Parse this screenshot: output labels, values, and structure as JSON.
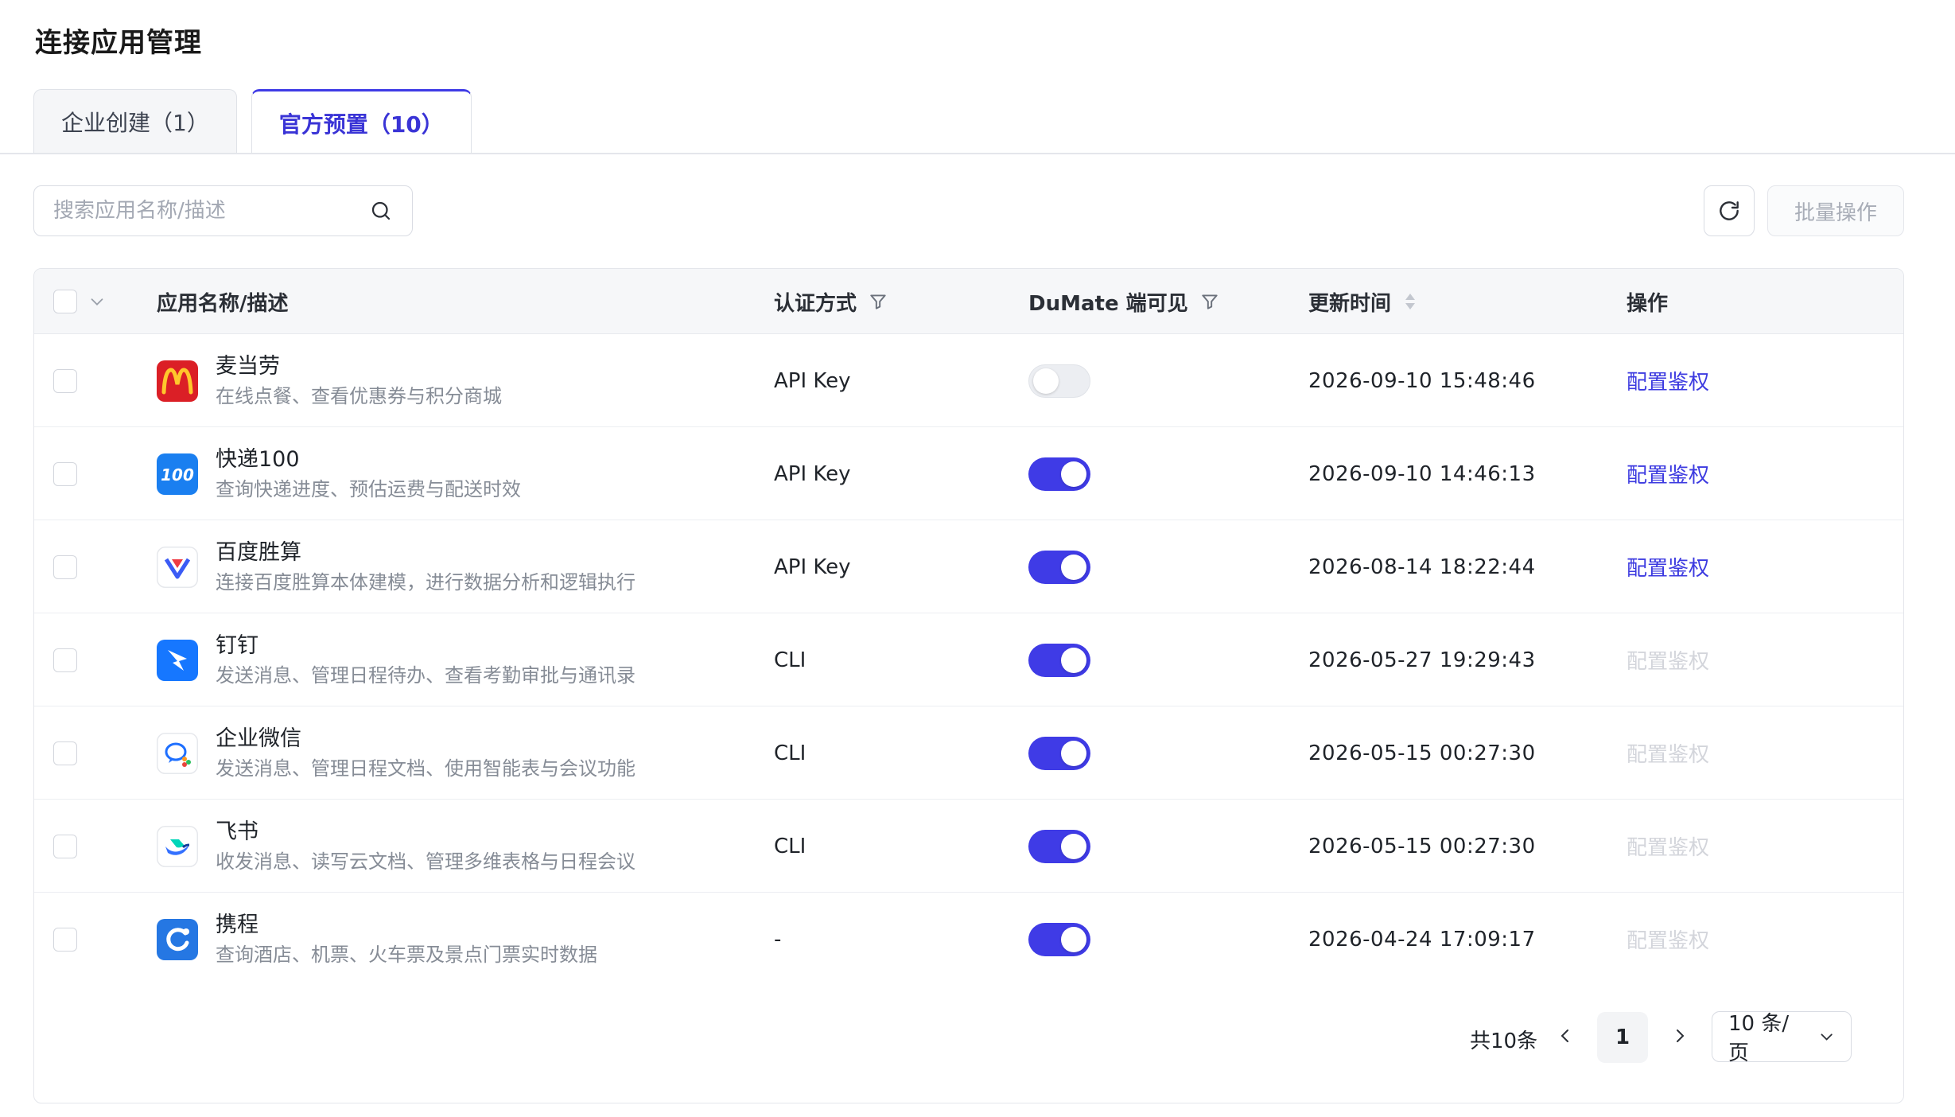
{
  "page": {
    "title": "连接应用管理"
  },
  "tabs": [
    {
      "label": "企业创建（1）",
      "active": false
    },
    {
      "label": "官方预置（10）",
      "active": true
    }
  ],
  "toolbar": {
    "search_placeholder": "搜索应用名称/描述",
    "batch_label": "批量操作"
  },
  "table": {
    "headers": {
      "name": "应用名称/描述",
      "auth": "认证方式",
      "visible": "DuMate 端可见",
      "updated": "更新时间",
      "action": "操作"
    },
    "rows": [
      {
        "name": "麦当劳",
        "desc": "在线点餐、查看优惠券与积分商城",
        "auth": "API Key",
        "visible": false,
        "updated": "2026-09-10 15:48:46",
        "action": "配置鉴权",
        "action_enabled": true,
        "icon": "mcdonalds-icon"
      },
      {
        "name": "快递100",
        "desc": "查询快递进度、预估运费与配送时效",
        "auth": "API Key",
        "visible": true,
        "updated": "2026-09-10 14:46:13",
        "action": "配置鉴权",
        "action_enabled": true,
        "icon": "kuaidi100-icon"
      },
      {
        "name": "百度胜算",
        "desc": "连接百度胜算本体建模，进行数据分析和逻辑执行",
        "auth": "API Key",
        "visible": true,
        "updated": "2026-08-14 18:22:44",
        "action": "配置鉴权",
        "action_enabled": true,
        "icon": "baidu-shengsuan-icon"
      },
      {
        "name": "钉钉",
        "desc": "发送消息、管理日程待办、查看考勤审批与通讯录",
        "auth": "CLI",
        "visible": true,
        "updated": "2026-05-27 19:29:43",
        "action": "配置鉴权",
        "action_enabled": false,
        "icon": "dingtalk-icon"
      },
      {
        "name": "企业微信",
        "desc": "发送消息、管理日程文档、使用智能表与会议功能",
        "auth": "CLI",
        "visible": true,
        "updated": "2026-05-15 00:27:30",
        "action": "配置鉴权",
        "action_enabled": false,
        "icon": "wecom-icon"
      },
      {
        "name": "飞书",
        "desc": "收发消息、读写云文档、管理多维表格与日程会议",
        "auth": "CLI",
        "visible": true,
        "updated": "2026-05-15 00:27:30",
        "action": "配置鉴权",
        "action_enabled": false,
        "icon": "feishu-icon"
      },
      {
        "name": "携程",
        "desc": "查询酒店、机票、火车票及景点门票实时数据",
        "auth": "-",
        "visible": true,
        "updated": "2026-04-24 17:09:17",
        "action": "配置鉴权",
        "action_enabled": false,
        "icon": "ctrip-icon"
      }
    ]
  },
  "pagination": {
    "total_label": "共10条",
    "current_page": "1",
    "page_size_label": "10 条/页"
  },
  "colors": {
    "accent": "#3f3be6",
    "link": "#3c3ae0",
    "disabled_link": "#d3d5db"
  }
}
